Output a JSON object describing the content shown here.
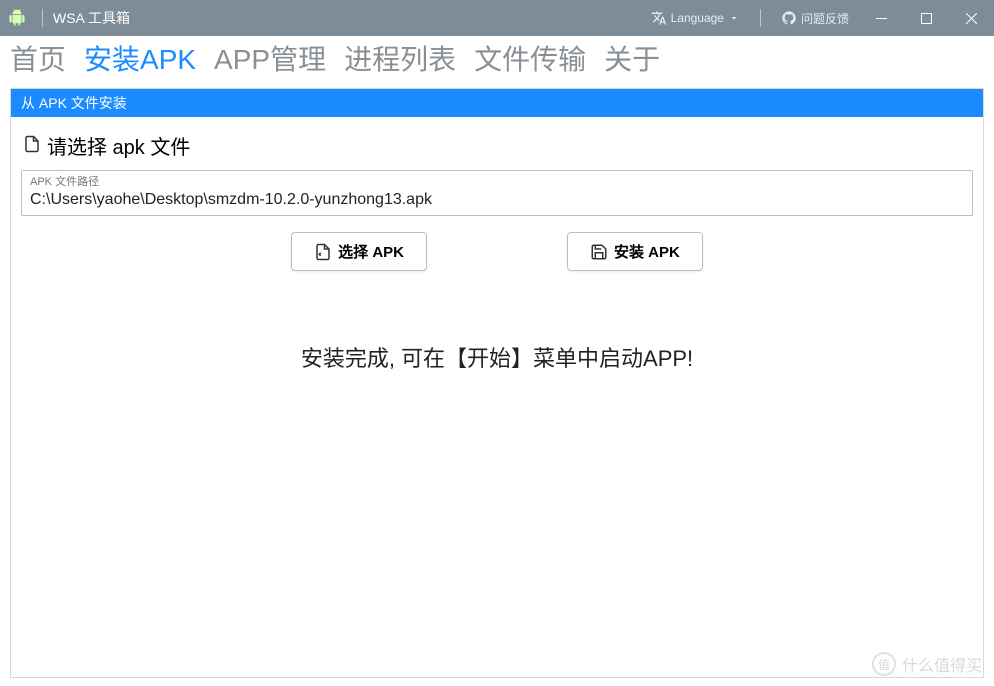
{
  "titlebar": {
    "app_title": "WSA 工具箱",
    "language_label": "Language",
    "feedback_label": "问题反馈"
  },
  "tabs": {
    "items": [
      {
        "label": "首页"
      },
      {
        "label": "安装APK"
      },
      {
        "label": "APP管理"
      },
      {
        "label": "进程列表"
      },
      {
        "label": "文件传输"
      },
      {
        "label": "关于"
      }
    ]
  },
  "panel": {
    "header": "从 APK 文件安装",
    "select_prompt": "请选择 apk 文件",
    "field_label": "APK 文件路径",
    "field_value": "C:\\Users\\yaohe\\Desktop\\smzdm-10.2.0-yunzhong13.apk",
    "choose_btn": "选择 APK",
    "install_btn": "安装 APK",
    "status": "安装完成, 可在【开始】菜单中启动APP!"
  },
  "watermark": {
    "badge": "值",
    "text": "什么值得买"
  }
}
